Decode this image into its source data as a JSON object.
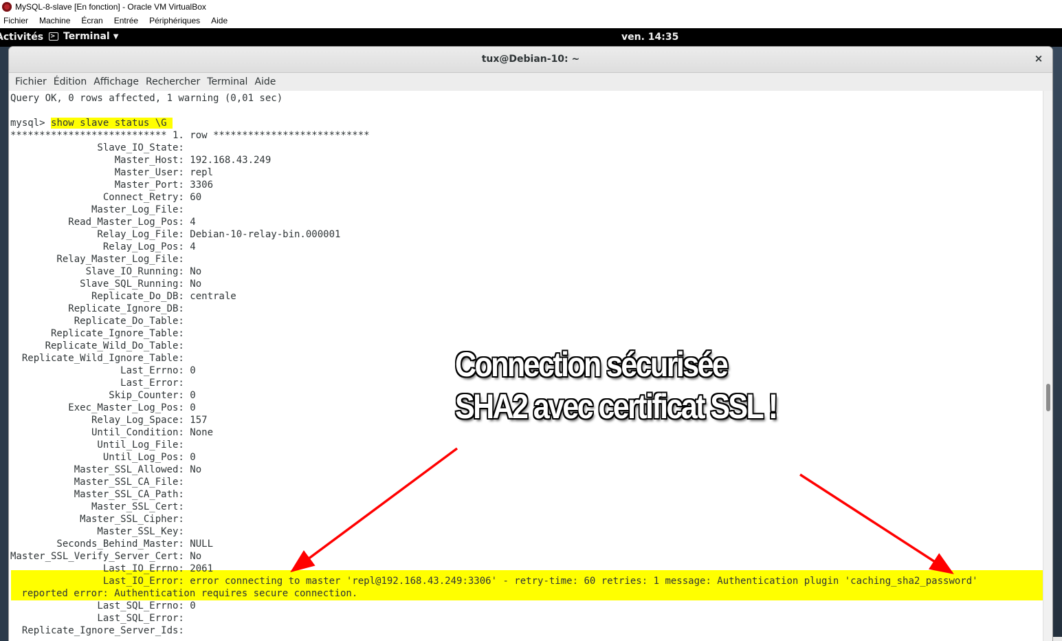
{
  "host_window": {
    "title": "MySQL-8-slave [En fonction] - Oracle VM VirtualBox",
    "menu": [
      "Fichier",
      "Machine",
      "Écran",
      "Entrée",
      "Périphériques",
      "Aide"
    ]
  },
  "gnome_bar": {
    "activities": "Activités",
    "app_name": "Terminal",
    "clock": "ven. 14:35"
  },
  "terminal": {
    "title": "tux@Debian-10: ~",
    "close": "×",
    "menu": [
      "Fichier",
      "Édition",
      "Affichage",
      "Rechercher",
      "Terminal",
      "Aide"
    ],
    "prompt": "mysql> ",
    "command": "show slave status \\G ",
    "lines": [
      "Query OK, 0 rows affected, 1 warning (0,01 sec)",
      "",
      "mysql> show slave status \\G",
      "*************************** 1. row ***************************",
      "               Slave_IO_State: ",
      "                  Master_Host: 192.168.43.249",
      "                  Master_User: repl",
      "                  Master_Port: 3306",
      "                Connect_Retry: 60",
      "              Master_Log_File: ",
      "          Read_Master_Log_Pos: 4",
      "               Relay_Log_File: Debian-10-relay-bin.000001",
      "                Relay_Log_Pos: 4",
      "        Relay_Master_Log_File: ",
      "             Slave_IO_Running: No",
      "            Slave_SQL_Running: No",
      "              Replicate_Do_DB: centrale",
      "          Replicate_Ignore_DB: ",
      "           Replicate_Do_Table: ",
      "       Replicate_Ignore_Table: ",
      "      Replicate_Wild_Do_Table: ",
      "  Replicate_Wild_Ignore_Table: ",
      "                   Last_Errno: 0",
      "                   Last_Error: ",
      "                 Skip_Counter: 0",
      "          Exec_Master_Log_Pos: 0",
      "              Relay_Log_Space: 157",
      "              Until_Condition: None",
      "               Until_Log_File: ",
      "                Until_Log_Pos: 0",
      "           Master_SSL_Allowed: No",
      "           Master_SSL_CA_File: ",
      "           Master_SSL_CA_Path: ",
      "              Master_SSL_Cert: ",
      "            Master_SSL_Cipher: ",
      "               Master_SSL_Key: ",
      "        Seconds_Behind_Master: NULL",
      "Master_SSL_Verify_Server_Cert: No",
      "                Last_IO_Errno: 2061",
      "                Last_IO_Error: error connecting to master 'repl@192.168.43.249:3306' - retry-time: 60 retries: 1 message: Authentication plugin 'caching_sha2_password'",
      " reported error: Authentication requires secure connection.",
      "               Last_SQL_Errno: 0",
      "               Last_SQL_Error: ",
      "  Replicate_Ignore_Server_Ids: "
    ]
  },
  "annotation": {
    "line1": "Connection sécurisée",
    "line2": "SHA2 avec certificat SSL !",
    "arrow_color": "#ff0000",
    "highlight_color": "#ffff00"
  }
}
